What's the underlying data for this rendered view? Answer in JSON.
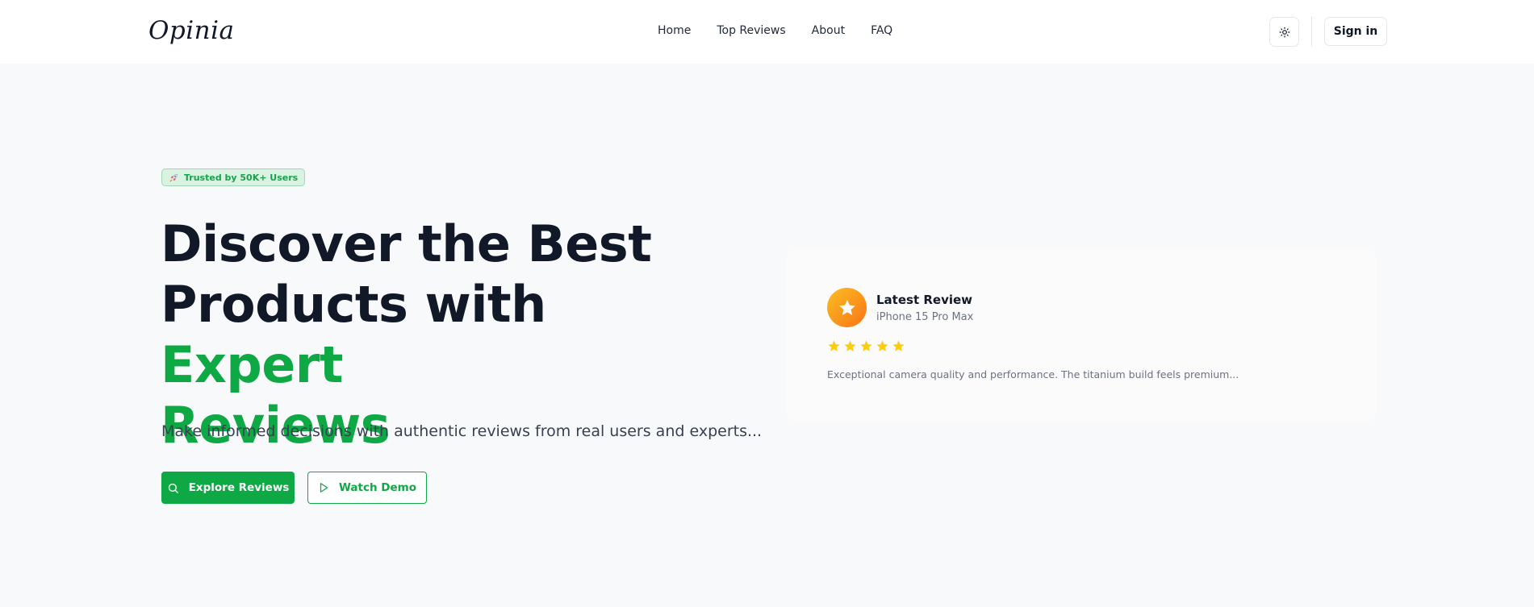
{
  "navbar": {
    "logo": "Opinia",
    "links": [
      "Home",
      "Top Reviews",
      "About",
      "FAQ"
    ],
    "theme_icon": "sun-icon",
    "signin_label": "Sign in"
  },
  "hero": {
    "badge": {
      "icon": "rocket-icon",
      "text": "Trusted by 50K+ Users"
    },
    "headline": {
      "line1": "Discover the Best",
      "line2_plain": "Products with ",
      "line2_accent": "Expert",
      "line3_accent": "Reviews"
    },
    "subtext": "Make informed decisions with authentic reviews from real users and experts...",
    "primary_button": {
      "icon": "search-icon",
      "label": "Explore Reviews"
    },
    "secondary_button": {
      "icon": "play-icon",
      "label": "Watch Demo"
    }
  },
  "review_card": {
    "avatar_icon": "star-icon",
    "title": "Latest Review",
    "product": "iPhone 15 Pro Max",
    "rating": 5,
    "excerpt": "Exceptional camera quality and performance. The titanium build feels premium..."
  },
  "colors": {
    "accent": "#0ea844",
    "star": "#facc15",
    "text": "#111827",
    "background": "#f8f9fb"
  }
}
